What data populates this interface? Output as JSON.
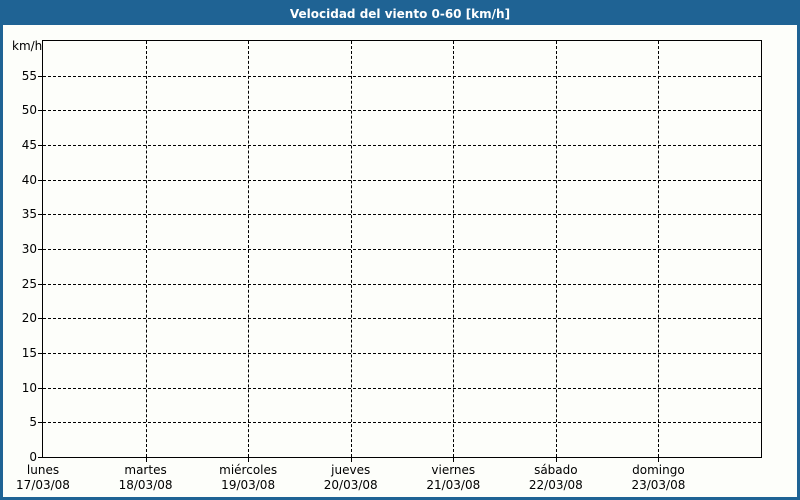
{
  "window": {
    "title": "Velocidad del viento 0-60 [km/h]"
  },
  "colors": {
    "titlebar": "#1f6394",
    "frame_border": "#1f6394",
    "background": "#fdfefa",
    "grid_and_text": "#000000",
    "title_text": "#ffffff"
  },
  "chart_data": {
    "type": "line",
    "title": "Velocidad del viento 0-60 [km/h]",
    "xlabel": "",
    "ylabel": "km/h",
    "ylim": [
      0,
      60
    ],
    "yticks": [
      0,
      5,
      10,
      15,
      20,
      25,
      30,
      35,
      40,
      45,
      50,
      55
    ],
    "categories": [
      "lunes",
      "martes",
      "miércoles",
      "jueves",
      "viernes",
      "sábado",
      "domingo"
    ],
    "category_dates": [
      "17/03/08",
      "18/03/08",
      "19/03/08",
      "20/03/08",
      "21/03/08",
      "22/03/08",
      "23/03/08"
    ],
    "series": [],
    "grid": "dashed",
    "legend_position": "none"
  }
}
